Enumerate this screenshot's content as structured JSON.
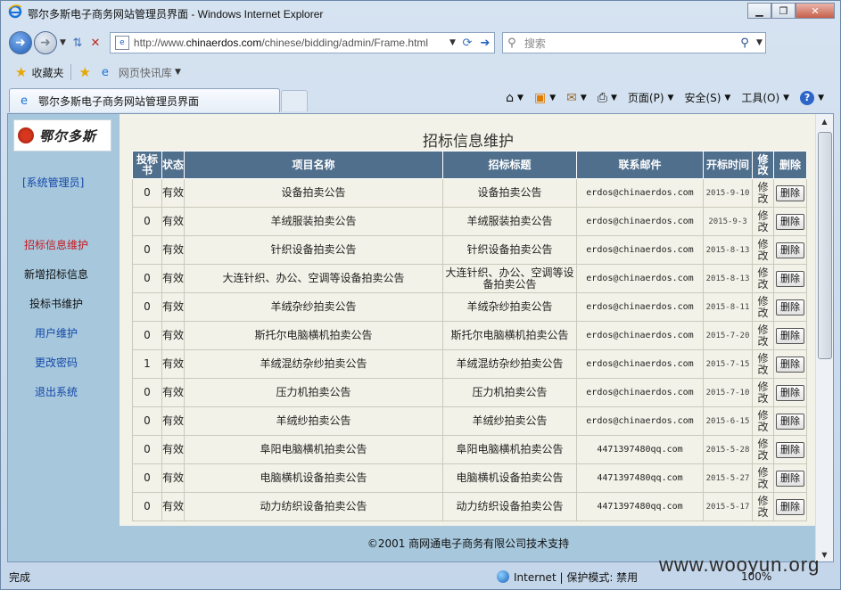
{
  "window": {
    "title": "鄂尔多斯电子商务网站管理员界面 - Windows Internet Explorer"
  },
  "addressbar": {
    "url_prefix": "http://www.",
    "url_domain": "chinaerdos.com",
    "url_path": "/chinese/bidding/admin/Frame.html",
    "search_placeholder": "搜索"
  },
  "favorites": {
    "label": "收藏夹",
    "quick_label": "网页快讯库"
  },
  "tab": {
    "title": "鄂尔多斯电子商务网站管理员界面"
  },
  "commandbar": {
    "page": "页面(P)",
    "safety": "安全(S)",
    "tools": "工具(O)"
  },
  "sidebar": {
    "logo_text": "鄂尔多斯",
    "admin": "[系统管理员]",
    "items": [
      "招标信息维护",
      "新增招标信息",
      "投标书维护",
      "用户维护",
      "更改密码",
      "退出系统"
    ]
  },
  "main": {
    "title": "招标信息维护",
    "columns": [
      "投标书",
      "状态",
      "项目名称",
      "招标标题",
      "联系邮件",
      "开标时间",
      "修改",
      "删除"
    ],
    "rows": [
      {
        "bids": "0",
        "status": "有效",
        "project": "设备拍卖公告",
        "title": "设备拍卖公告",
        "email": "erdos@chinaerdos.com",
        "date": "2015-9-10",
        "edit": "修改",
        "del": "删除"
      },
      {
        "bids": "0",
        "status": "有效",
        "project": "羊绒服装拍卖公告",
        "title": "羊绒服装拍卖公告",
        "email": "erdos@chinaerdos.com",
        "date": "2015-9-3",
        "edit": "修改",
        "del": "删除"
      },
      {
        "bids": "0",
        "status": "有效",
        "project": "针织设备拍卖公告",
        "title": "针织设备拍卖公告",
        "email": "erdos@chinaerdos.com",
        "date": "2015-8-13",
        "edit": "修改",
        "del": "删除"
      },
      {
        "bids": "0",
        "status": "有效",
        "project": "大连针织、办公、空调等设备拍卖公告",
        "title": "大连针织、办公、空调等设备拍卖公告",
        "email": "erdos@chinaerdos.com",
        "date": "2015-8-13",
        "edit": "修改",
        "del": "删除"
      },
      {
        "bids": "0",
        "status": "有效",
        "project": "羊绒杂纱拍卖公告",
        "title": "羊绒杂纱拍卖公告",
        "email": "erdos@chinaerdos.com",
        "date": "2015-8-11",
        "edit": "修改",
        "del": "删除"
      },
      {
        "bids": "0",
        "status": "有效",
        "project": "斯托尔电脑横机拍卖公告",
        "title": "斯托尔电脑横机拍卖公告",
        "email": "erdos@chinaerdos.com",
        "date": "2015-7-20",
        "edit": "修改",
        "del": "删除"
      },
      {
        "bids": "1",
        "status": "有效",
        "project": "羊绒混纺杂纱拍卖公告",
        "title": "羊绒混纺杂纱拍卖公告",
        "email": "erdos@chinaerdos.com",
        "date": "2015-7-15",
        "edit": "修改",
        "del": "删除"
      },
      {
        "bids": "0",
        "status": "有效",
        "project": "压力机拍卖公告",
        "title": "压力机拍卖公告",
        "email": "erdos@chinaerdos.com",
        "date": "2015-7-10",
        "edit": "修改",
        "del": "删除"
      },
      {
        "bids": "0",
        "status": "有效",
        "project": "羊绒纱拍卖公告",
        "title": "羊绒纱拍卖公告",
        "email": "erdos@chinaerdos.com",
        "date": "2015-6-15",
        "edit": "修改",
        "del": "删除"
      },
      {
        "bids": "0",
        "status": "有效",
        "project": "阜阳电脑横机拍卖公告",
        "title": "阜阳电脑横机拍卖公告",
        "email": "4471397480qq.com",
        "date": "2015-5-28",
        "edit": "修改",
        "del": "删除"
      },
      {
        "bids": "0",
        "status": "有效",
        "project": "电脑横机设备拍卖公告",
        "title": "电脑横机设备拍卖公告",
        "email": "4471397480qq.com",
        "date": "2015-5-27",
        "edit": "修改",
        "del": "删除"
      },
      {
        "bids": "0",
        "status": "有效",
        "project": "动力纺织设备拍卖公告",
        "title": "动力纺织设备拍卖公告",
        "email": "4471397480qq.com",
        "date": "2015-5-17",
        "edit": "修改",
        "del": "删除"
      }
    ],
    "footer": "©2001 商网通电子商务有限公司技术支持"
  },
  "statusbar": {
    "status": "完成",
    "zone": "Internet | 保护模式: 禁用",
    "zoom": "100%"
  },
  "watermark": "www.wooyun.org"
}
